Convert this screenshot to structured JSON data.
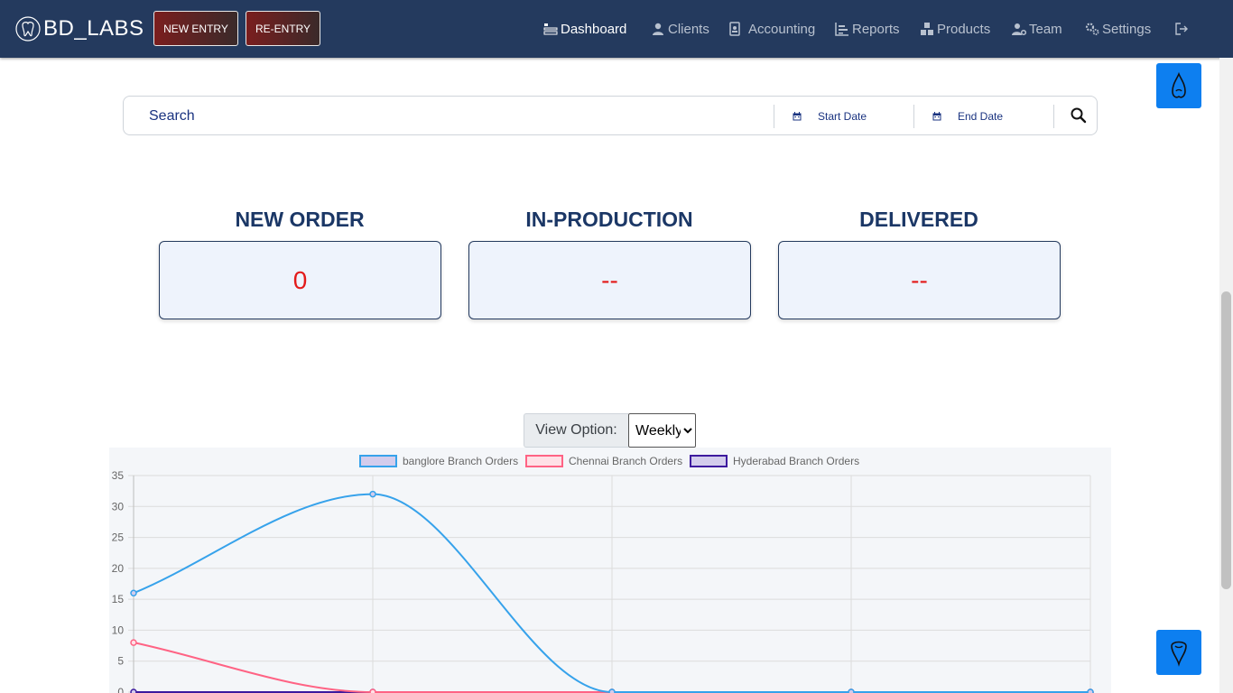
{
  "header": {
    "brand": "BD_LABS",
    "new_entry": "NEW ENTRY",
    "re_entry": "RE-ENTRY",
    "nav": [
      {
        "label": "Dashboard",
        "icon": "dashboard-icon",
        "active": true
      },
      {
        "label": "Clients",
        "icon": "user-icon"
      },
      {
        "label": "Accounting",
        "icon": "id-card-icon"
      },
      {
        "label": "Reports",
        "icon": "chart-icon"
      },
      {
        "label": "Products",
        "icon": "cubes-icon"
      },
      {
        "label": "Team",
        "icon": "user-gear-icon"
      },
      {
        "label": "Settings",
        "icon": "gears-icon"
      },
      {
        "label": "",
        "icon": "logout-icon"
      }
    ]
  },
  "search": {
    "placeholder": "Search",
    "start_date": "Start Date",
    "end_date": "End Date"
  },
  "stats": [
    {
      "title": "NEW ORDER",
      "value": "0"
    },
    {
      "title": "IN-PRODUCTION",
      "value": "--"
    },
    {
      "title": "DELIVERED",
      "value": "--"
    }
  ],
  "view": {
    "label": "View Option:",
    "selected": "Weekly"
  },
  "chart_data": {
    "type": "line",
    "x": [
      0,
      1,
      2,
      3,
      4
    ],
    "ylim": [
      0,
      35
    ],
    "yticks": [
      0,
      5,
      10,
      15,
      20,
      25,
      30,
      35
    ],
    "grid": true,
    "legend_position": "top",
    "series": [
      {
        "name": "banglore Branch Orders",
        "color": "#36a2eb",
        "fill": "#d3ccec",
        "values": [
          16,
          32,
          0,
          0,
          0
        ]
      },
      {
        "name": "Chennai Branch Orders",
        "color": "#ff6384",
        "fill": "#ffe0e6",
        "values": [
          8,
          0,
          0,
          0,
          0
        ]
      },
      {
        "name": "Hyderabad Branch Orders",
        "color": "#3d1a9e",
        "fill": "#d3ccec",
        "values": [
          0,
          0,
          0,
          0,
          0
        ]
      }
    ]
  }
}
